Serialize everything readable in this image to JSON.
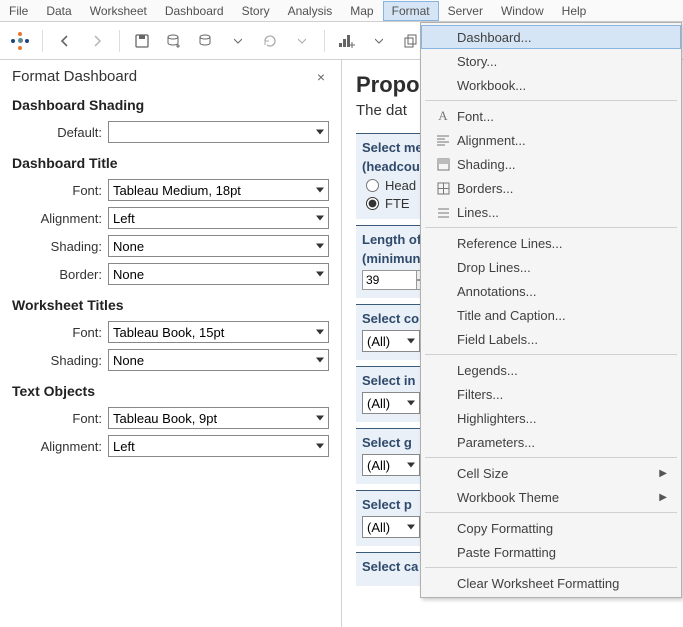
{
  "menubar": [
    "File",
    "Data",
    "Worksheet",
    "Dashboard",
    "Story",
    "Analysis",
    "Map",
    "Format",
    "Server",
    "Window",
    "Help"
  ],
  "active_menu": "Format",
  "format_menu": {
    "items": [
      {
        "label": "Dashboard...",
        "icon": "",
        "hover": true
      },
      {
        "label": "Story...",
        "icon": ""
      },
      {
        "label": "Workbook...",
        "icon": ""
      },
      {
        "sep": true
      },
      {
        "label": "Font...",
        "icon": "A"
      },
      {
        "label": "Alignment...",
        "icon": "align"
      },
      {
        "label": "Shading...",
        "icon": "shade"
      },
      {
        "label": "Borders...",
        "icon": "grid"
      },
      {
        "label": "Lines...",
        "icon": "lines"
      },
      {
        "sep": true
      },
      {
        "label": "Reference Lines..."
      },
      {
        "label": "Drop Lines..."
      },
      {
        "label": "Annotations..."
      },
      {
        "label": "Title and Caption..."
      },
      {
        "label": "Field Labels..."
      },
      {
        "sep": true
      },
      {
        "label": "Legends..."
      },
      {
        "label": "Filters..."
      },
      {
        "label": "Highlighters..."
      },
      {
        "label": "Parameters..."
      },
      {
        "sep": true
      },
      {
        "label": "Cell Size",
        "sub": true
      },
      {
        "label": "Workbook Theme",
        "sub": true
      },
      {
        "sep": true
      },
      {
        "label": "Copy Formatting"
      },
      {
        "label": "Paste Formatting"
      },
      {
        "sep": true
      },
      {
        "label": "Clear Worksheet Formatting"
      }
    ]
  },
  "panel": {
    "title": "Format Dashboard",
    "sections": {
      "shading": {
        "head": "Dashboard Shading",
        "default_label": "Default:",
        "default_value": ""
      },
      "dash_title": {
        "head": "Dashboard Title",
        "font_label": "Font:",
        "font_value": "Tableau Medium, 18pt",
        "align_label": "Alignment:",
        "align_value": "Left",
        "shade_label": "Shading:",
        "shade_value": "None",
        "border_label": "Border:",
        "border_value": "None"
      },
      "ws_titles": {
        "head": "Worksheet Titles",
        "font_label": "Font:",
        "font_value": "Tableau Book, 15pt",
        "shade_label": "Shading:",
        "shade_value": "None"
      },
      "text_obj": {
        "head": "Text Objects",
        "font_label": "Font:",
        "font_value": "Tableau Book, 9pt",
        "align_label": "Alignment:",
        "align_value": "Left"
      }
    }
  },
  "content": {
    "title": "Propo",
    "subtitle": "The dat",
    "select_measure_label": "Select me",
    "select_measure_sub": "(headcou",
    "radio_head": "Head",
    "radio_fte": "FTE",
    "length_label": "Length of",
    "length_sub": "(minimun",
    "length_value": "39",
    "select_c_label": "Select co",
    "val_all": "(All)",
    "select_i_label": "Select in",
    "select_g_label": "Select g",
    "select_p_label": "Select p",
    "select_ca_label": "Select ca"
  }
}
